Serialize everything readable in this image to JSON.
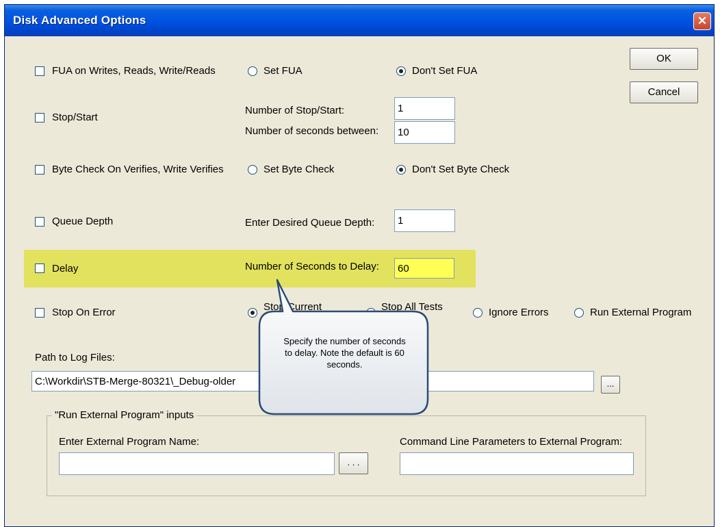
{
  "window": {
    "title": "Disk Advanced Options",
    "close_glyph": "✕"
  },
  "buttons": {
    "ok": "OK",
    "cancel": "Cancel",
    "browse_log": "...",
    "browse_ext": ". . ."
  },
  "options": {
    "fua": {
      "label": "FUA on Writes, Reads, Write/Reads",
      "checked": false,
      "radio_set": "Set FUA",
      "radio_dont": "Don't Set FUA",
      "selected": "Don't Set FUA"
    },
    "stop_start": {
      "label": "Stop/Start",
      "checked": false,
      "count_label": "Number of Stop/Start:",
      "count_value": "1",
      "seconds_label": "Number of seconds between:",
      "seconds_value": "10"
    },
    "byte_check": {
      "label": "Byte Check On Verifies, Write Verifies",
      "checked": false,
      "radio_set": "Set  Byte Check",
      "radio_dont": "Don't Set Byte Check",
      "selected": "Don't Set Byte Check"
    },
    "queue_depth": {
      "label": "Queue Depth",
      "checked": false,
      "field_label": "Enter Desired Queue Depth:",
      "value": "1"
    },
    "delay": {
      "label": "Delay",
      "checked": false,
      "field_label": "Number of Seconds to Delay:",
      "value": "60"
    },
    "stop_on_error": {
      "label": "Stop On Error",
      "checked": false,
      "radio_current": "Stop Current",
      "radio_all": "Stop All Tests",
      "radio_ignore": "Ignore Errors",
      "radio_external": "Run External Program",
      "selected": "Stop Current"
    }
  },
  "log_path": {
    "label": "Path to Log Files:",
    "value": "C:\\Workdir\\STB-Merge-80321\\_Debug-older"
  },
  "external_group": {
    "legend": "\"Run External Program\" inputs",
    "program_label": "Enter External Program Name:",
    "program_value": "",
    "params_label": "Command Line Parameters to External Program:",
    "params_value": ""
  },
  "callout": {
    "text": "Specify the number of seconds to delay. Note the default is 60 seconds.",
    "highlight_color": "#e2e25e"
  },
  "colors": {
    "titlebar": "#0054e3",
    "dialog_bg": "#ece9d8",
    "close_button": "#c9452c",
    "callout_border": "#2b4b78"
  }
}
